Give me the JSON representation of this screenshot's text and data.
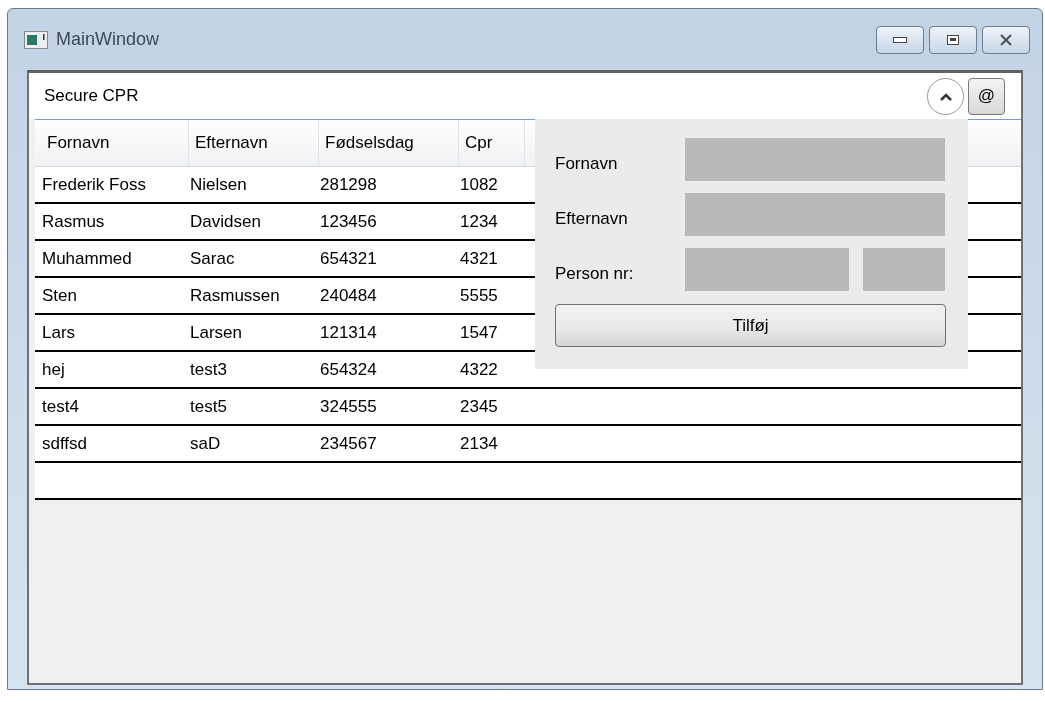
{
  "window": {
    "title": "MainWindow"
  },
  "header": {
    "title": "Secure CPR",
    "collapse_button": {
      "expanded": true
    },
    "at_button": "@"
  },
  "table": {
    "columns": [
      "Fornavn",
      "Efternavn",
      "Fødselsdag",
      "Cpr"
    ],
    "rows": [
      [
        "Frederik Foss",
        "Nielsen",
        "281298",
        "1082"
      ],
      [
        "Rasmus",
        "Davidsen",
        "123456",
        "1234"
      ],
      [
        "Muhammed",
        "Sarac",
        "654321",
        "4321"
      ],
      [
        "Sten",
        "Rasmussen",
        "240484",
        "5555"
      ],
      [
        "Lars",
        "Larsen",
        "121314",
        "1547"
      ],
      [
        "hej",
        "test3",
        "654324",
        "4322"
      ],
      [
        "test4",
        "test5",
        "324555",
        "2345"
      ],
      [
        "sdffsd",
        "saD",
        "234567",
        "2134"
      ]
    ]
  },
  "form": {
    "fields": [
      {
        "label": "Fornavn"
      },
      {
        "label": "Efternavn"
      },
      {
        "label": "Person nr:"
      }
    ],
    "submit": "Tilføj"
  }
}
